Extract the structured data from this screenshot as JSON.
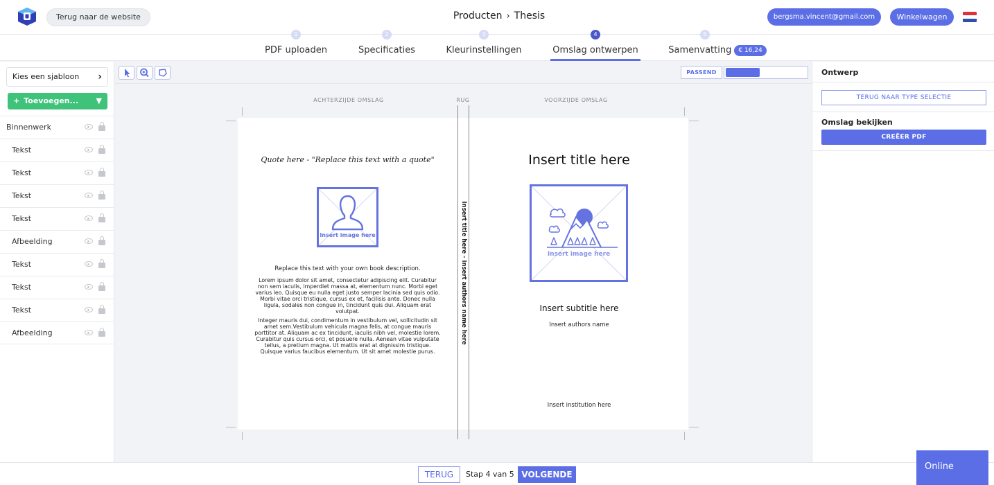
{
  "header": {
    "back_to_site": "Terug naar de website",
    "breadcrumb": [
      "Producten",
      "Thesis"
    ],
    "breadcrumb_sep": "›",
    "email": "bergsma.vincent@gmail.com",
    "cart": "Winkelwagen"
  },
  "steps": [
    {
      "num": "1",
      "label": "PDF uploaden"
    },
    {
      "num": "2",
      "label": "Specificaties"
    },
    {
      "num": "3",
      "label": "Kleurinstellingen"
    },
    {
      "num": "4",
      "label": "Omslag ontwerpen",
      "active": true
    },
    {
      "num": "5",
      "label": "Samenvatting"
    }
  ],
  "price": "€ 16,24",
  "sidebar": {
    "template_button": "Kies een sjabloon",
    "add_button": "Toevoegen...",
    "layers": [
      "Binnenwerk",
      "Tekst",
      "Tekst",
      "Tekst",
      "Tekst",
      "Afbeelding",
      "Tekst",
      "Tekst",
      "Tekst",
      "Afbeelding"
    ]
  },
  "toolbar": {
    "fit_label": "PASSEND",
    "zoom_fraction": 0.42
  },
  "canvas": {
    "label_back": "ACHTERZIJDE OMSLAG",
    "label_spine": "RUG",
    "label_front": "VOORZIJDE OMSLAG",
    "spine_text": "Insert title here - insert authors name here",
    "back": {
      "quote": "Quote here - \"Replace this text with a quote\"",
      "image_caption": "Insert image here",
      "desc_title": "Replace this text with your own book description.",
      "para1": "Lorem ipsum dolor sit amet, consectetur adipiscing elit. Curabitur non sem iaculis, imperdiet massa at, elementum nunc. Morbi eget varius leo. Quisque eu nulla eget justo semper lacinia sed quis odio. Morbi vitae orci tristique, cursus ex et, facilisis ante. Donec nulla ligula, sodales non congue in, tincidunt quis dui. Aliquam erat volutpat.",
      "para2": "Integer mauris dui, condimentum in vestibulum vel, sollicitudin sit amet sem.Vestibulum vehicula magna felis, at congue mauris porttitor at. Aliquam ac ex tincidunt, iaculis nibh vel, molestie lorem. Curabitur quis cursus orci, et posuere nulla. Aenean vitae vulputate tellus, a pretium magna. Ut mattis erat at dignissim tristique. Quisque varius faucibus elementum. Ut sit amet molestie purus."
    },
    "front": {
      "title": "Insert title here",
      "image_caption": "Insert image here",
      "subtitle": "Insert subtitle here",
      "author": "Insert authors name",
      "institution": "Insert institution here"
    }
  },
  "right_panel": {
    "title": "Ontwerp",
    "back_to_type": "TERUG NAAR TYPE SELECTIE",
    "view_cover": "Omslag bekijken",
    "create_pdf": "CREËER PDF"
  },
  "bottom": {
    "back": "TERUG",
    "step_text": "Stap 4 van 5",
    "next": "VOLGENDE"
  },
  "chat": {
    "label": "Online"
  },
  "colors": {
    "accent": "#5b6ee6",
    "add_green": "#3fc37a",
    "placeholder_blue": "#6473e0"
  }
}
